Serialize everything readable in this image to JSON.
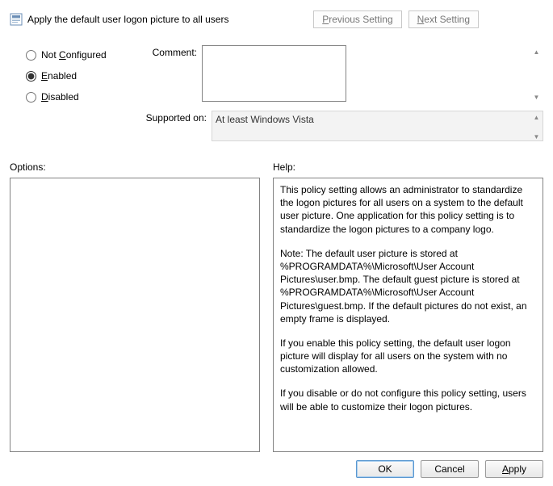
{
  "title": "Apply the default user logon picture to all users",
  "nav": {
    "prev_html": "<span class='ul'>P</span>revious Setting",
    "next_html": "<span class='ul'>N</span>ext Setting"
  },
  "radios": {
    "not_configured_html": "Not <span class='ul'>C</span>onfigured",
    "enabled_html": "<span class='ul'>E</span>nabled",
    "disabled_html": "<span class='ul'>D</span>isabled",
    "selected": "enabled"
  },
  "comment_label_html": "Co<span class='ul'>m</span>ment:",
  "comment_value": "",
  "supported_label": "Supported on:",
  "supported_value": "At least Windows Vista",
  "options_label": "Options:",
  "help_label": "Help:",
  "help_paragraphs": [
    "This policy setting allows an administrator to standardize the logon pictures for all users on a system to the default user picture. One application for this policy setting is to standardize the logon pictures to a company logo.",
    "Note: The default user picture is stored at %PROGRAMDATA%\\Microsoft\\User Account Pictures\\user.bmp. The default guest picture is stored at %PROGRAMDATA%\\Microsoft\\User Account Pictures\\guest.bmp. If the default pictures do not exist, an empty frame is displayed.",
    "If you enable this policy setting, the default user logon picture will display for all users on the system with no customization allowed.",
    "If you disable or do not configure this policy setting, users will be able to customize their logon pictures."
  ],
  "buttons": {
    "ok": "OK",
    "cancel": "Cancel",
    "apply_html": "<span class='ul'>A</span>pply"
  }
}
